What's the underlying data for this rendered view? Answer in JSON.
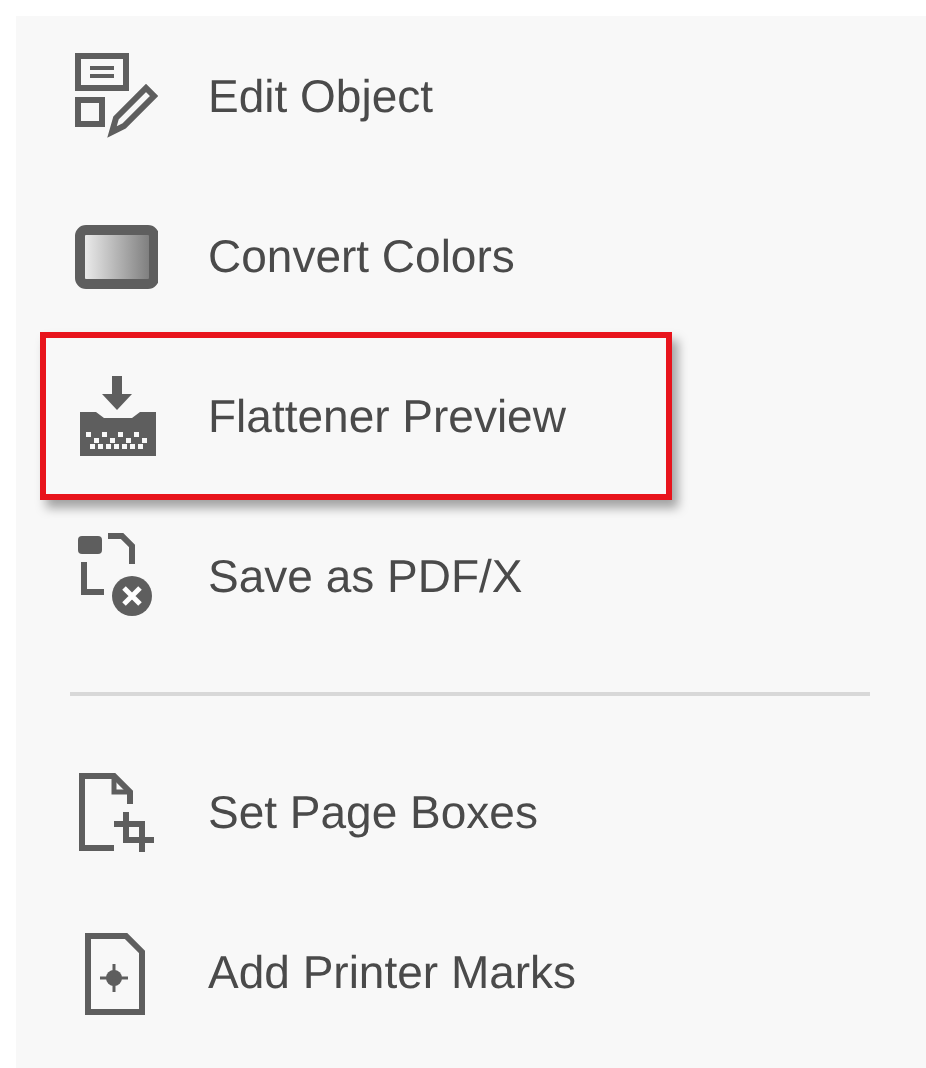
{
  "menu": {
    "sections": [
      {
        "items": [
          {
            "kind": "edit-object",
            "label": "Edit Object",
            "highlighted": false
          },
          {
            "kind": "convert-colors",
            "label": "Convert Colors",
            "highlighted": false
          },
          {
            "kind": "flattener",
            "label": "Flattener Preview",
            "highlighted": true
          },
          {
            "kind": "pdfx",
            "label": "Save as PDF/X",
            "highlighted": false
          }
        ]
      },
      {
        "items": [
          {
            "kind": "page-boxes",
            "label": "Set Page Boxes",
            "highlighted": false
          },
          {
            "kind": "printer-marks",
            "label": "Add Printer Marks",
            "highlighted": false
          }
        ]
      }
    ]
  }
}
